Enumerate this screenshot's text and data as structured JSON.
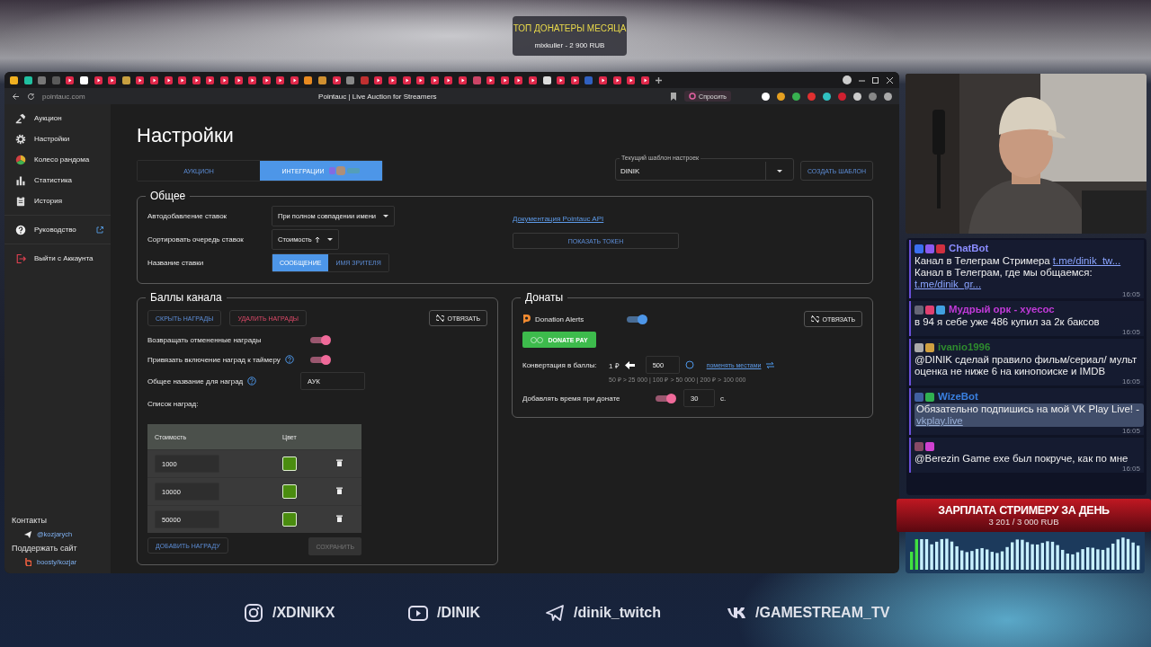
{
  "top_donors": {
    "title": "ТОП ДОНАТЕРЫ МЕСЯЦА",
    "entry": "mixkuller - 2 900 RUB"
  },
  "browser": {
    "address": "pointauc.com",
    "page_title": "Pointauc | Live Auction for Streamers",
    "ask_button": "Спросить"
  },
  "sidebar": {
    "items": [
      {
        "kind": "auction",
        "label": "Аукцион"
      },
      {
        "kind": "settings",
        "label": "Настройки"
      },
      {
        "kind": "wheel",
        "label": "Колесо рандома"
      },
      {
        "kind": "stats",
        "label": "Статистика"
      },
      {
        "kind": "history",
        "label": "История"
      },
      {
        "kind": "guide",
        "label": "Руководство"
      },
      {
        "kind": "logout",
        "label": "Выйти с Аккаунта"
      }
    ],
    "contacts_title": "Контакты",
    "contact_link": "@kozjarych",
    "support_title": "Поддержать сайт",
    "support_link": "boosty/kozjar"
  },
  "settings": {
    "title": "Настройки",
    "tabs": [
      {
        "label": "АУКЦИОН",
        "selected": false
      },
      {
        "label": "ИНТЕГРАЦИИ",
        "selected": true
      }
    ],
    "template": {
      "label": "Текущий шаблон настроек",
      "value": "DINIK"
    },
    "create_template_button": "СОЗДАТЬ ШАБЛОН"
  },
  "general": {
    "title": "Общее",
    "auto_add": {
      "label": "Автодобавление ставок",
      "value": "При полном совпадении имени"
    },
    "sort": {
      "label": "Сортировать очередь ставок",
      "value": "Стоимость"
    },
    "bid_name": {
      "label": "Название ставки",
      "options": [
        {
          "label": "СООБЩЕНИЕ",
          "selected": true
        },
        {
          "label": "ИМЯ ЗРИТЕЛЯ",
          "selected": false
        }
      ]
    },
    "api_link": "Документация Pointauc API",
    "show_token_button": "ПОКАЗАТЬ ТОКЕН"
  },
  "channel_points": {
    "title": "Баллы канала",
    "hide_button": "СКРЫТЬ НАГРАДЫ",
    "delete_button": "УДАЛИТЬ НАГРАДЫ",
    "unlink_button": "ОТВЯЗАТЬ",
    "toggles": [
      {
        "label": "Возвращать отмененные награды",
        "on": true,
        "help": false
      },
      {
        "label": "Привязать включение наград к таймеру",
        "on": true,
        "help": true
      }
    ],
    "reward_name": {
      "label": "Общее название для наград",
      "value": "АУК"
    },
    "list_label": "Список наград:",
    "columns": [
      "Стоимость",
      "Цвет"
    ],
    "rewards": [
      {
        "cost": "1000",
        "color": "#4a8c0f"
      },
      {
        "cost": "10000",
        "color": "#4a8c0f"
      },
      {
        "cost": "50000",
        "color": "#4a8c0f"
      }
    ],
    "add_button": "ДОБАВИТЬ НАГРАДУ",
    "save_button": {
      "label": "СОХРАНИТЬ",
      "disabled": true
    }
  },
  "donations": {
    "title": "Донаты",
    "donation_alerts": {
      "name": "Donation Alerts",
      "on": true
    },
    "donate_pay_button": "DONATE PAY",
    "unlink_button": "ОТВЯЗАТЬ",
    "conversion": {
      "label": "Конвертация в баллы:",
      "from": "1 ₽",
      "value": "500",
      "swap_link": "поменять местами",
      "hint": "50 ₽ > 25 000 | 100 ₽ > 50 000 | 200 ₽ > 100 000"
    },
    "add_time": {
      "label": "Добавлять время при донате",
      "on": true,
      "value": "30",
      "unit": "с."
    }
  },
  "chat": {
    "messages": [
      {
        "user": "ChatBot",
        "color": "#8a8cff",
        "parts": [
          {
            "text": "Канал в Телеграм Стримера "
          },
          {
            "link": "t.me/dinik_tw..."
          },
          {
            "text": " Канал в Телеграм, где мы общаемся: "
          },
          {
            "link": "t.me/dinik_gr..."
          }
        ],
        "highlighted": false,
        "time": "16:05"
      },
      {
        "user": "Мудрый орк - хуесос",
        "color": "#c13ad8",
        "parts": [
          {
            "text": "в 94 я себе уже 486 купил за 2к баксов"
          }
        ],
        "highlighted": false,
        "time": "16:05"
      },
      {
        "user": "ivanio1996",
        "color": "#2e8b2e",
        "parts": [
          {
            "text": "@DINIK сделай правило фильм/сериал/ мульт оценка не ниже 6 на кинопоиске и IMDB"
          }
        ],
        "highlighted": false,
        "time": "16:05"
      },
      {
        "user": "WizeBot",
        "color": "#3a80e0",
        "parts": [
          {
            "text": "Обязательно подпишись на мой VK Play Live! - "
          },
          {
            "link": "vkplay.live"
          }
        ],
        "highlighted": true,
        "time": "16:05"
      },
      {
        "parts": [
          {
            "text": "@Berezin Game exe был покруче, как по мне"
          }
        ],
        "highlighted": false,
        "time": "16:05"
      }
    ]
  },
  "goal": {
    "title": "ЗАРПЛАТА СТРИМЕРУ ЗА ДЕНЬ",
    "amount": "3 201 / 3 000 RUB"
  },
  "socials": [
    {
      "kind": "instagram",
      "handle": "/XDINIKX"
    },
    {
      "kind": "youtube",
      "handle": "/DINIK"
    },
    {
      "kind": "telegram",
      "handle": "/dinik_twitch"
    },
    {
      "kind": "vk",
      "handle": "/GAMESTREAM_TV"
    }
  ]
}
